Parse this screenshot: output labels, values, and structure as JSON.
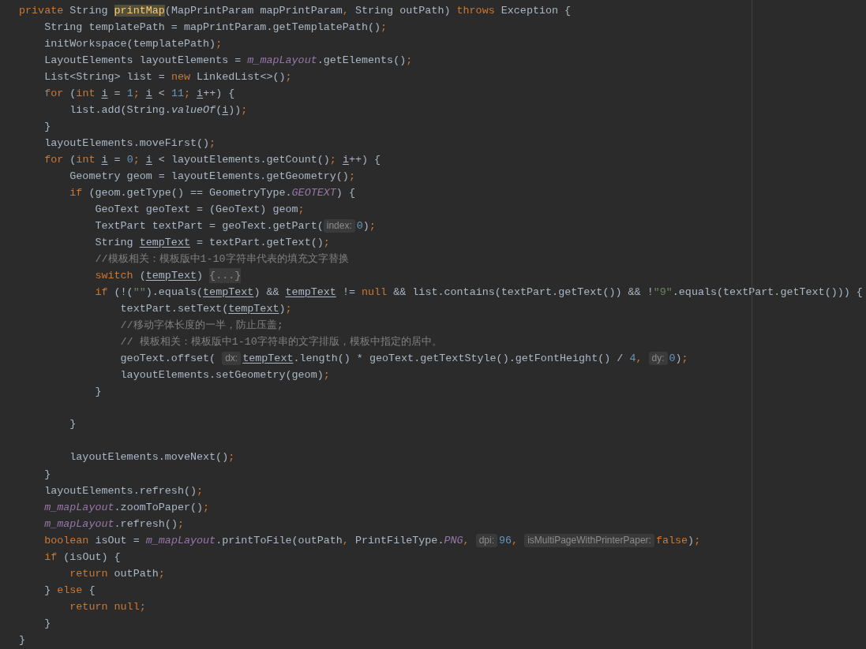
{
  "editor": {
    "lines": [
      {
        "tokens": [
          {
            "kind": "kw",
            "text": "private"
          },
          {
            "kind": "plain",
            "text": " String "
          },
          {
            "kind": "decl",
            "text": "printMap"
          },
          {
            "kind": "plain",
            "text": "(MapPrintParam mapPrintParam"
          },
          {
            "kind": "punct",
            "text": ","
          },
          {
            "kind": "plain",
            "text": " String outPath) "
          },
          {
            "kind": "kw",
            "text": "throws"
          },
          {
            "kind": "plain",
            "text": " Exception {"
          }
        ]
      },
      {
        "tokens": [
          {
            "kind": "plain",
            "text": "    String templatePath = mapPrintParam.getTemplatePath()"
          },
          {
            "kind": "punct",
            "text": ";"
          }
        ]
      },
      {
        "tokens": [
          {
            "kind": "plain",
            "text": "    initWorkspace(templatePath)"
          },
          {
            "kind": "punct",
            "text": ";"
          }
        ]
      },
      {
        "tokens": [
          {
            "kind": "plain",
            "text": "    LayoutElements layoutElements = "
          },
          {
            "kind": "field",
            "text": "m_mapLayout"
          },
          {
            "kind": "plain",
            "text": ".getElements()"
          },
          {
            "kind": "punct",
            "text": ";"
          }
        ]
      },
      {
        "tokens": [
          {
            "kind": "plain",
            "text": "    List<String> list = "
          },
          {
            "kind": "kw",
            "text": "new"
          },
          {
            "kind": "plain",
            "text": " LinkedList<>()"
          },
          {
            "kind": "punct",
            "text": ";"
          }
        ]
      },
      {
        "tokens": [
          {
            "kind": "kw",
            "text": "    for"
          },
          {
            "kind": "plain",
            "text": " ("
          },
          {
            "kind": "kw",
            "text": "int "
          },
          {
            "kind": "var",
            "text": "i"
          },
          {
            "kind": "plain",
            "text": " = "
          },
          {
            "kind": "num",
            "text": "1"
          },
          {
            "kind": "punct",
            "text": "; "
          },
          {
            "kind": "var",
            "text": "i"
          },
          {
            "kind": "plain",
            "text": " < "
          },
          {
            "kind": "num",
            "text": "11"
          },
          {
            "kind": "punct",
            "text": "; "
          },
          {
            "kind": "var",
            "text": "i"
          },
          {
            "kind": "plain",
            "text": "++) {"
          }
        ]
      },
      {
        "tokens": [
          {
            "kind": "plain",
            "text": "        list.add(String."
          },
          {
            "kind": "static",
            "text": "valueOf"
          },
          {
            "kind": "plain",
            "text": "("
          },
          {
            "kind": "var",
            "text": "i"
          },
          {
            "kind": "plain",
            "text": "))"
          },
          {
            "kind": "punct",
            "text": ";"
          }
        ]
      },
      {
        "tokens": [
          {
            "kind": "plain",
            "text": "    }"
          }
        ]
      },
      {
        "tokens": [
          {
            "kind": "plain",
            "text": "    layoutElements.moveFirst()"
          },
          {
            "kind": "punct",
            "text": ";"
          }
        ]
      },
      {
        "tokens": [
          {
            "kind": "kw",
            "text": "    for"
          },
          {
            "kind": "plain",
            "text": " ("
          },
          {
            "kind": "kw",
            "text": "int "
          },
          {
            "kind": "var",
            "text": "i"
          },
          {
            "kind": "plain",
            "text": " = "
          },
          {
            "kind": "num",
            "text": "0"
          },
          {
            "kind": "punct",
            "text": "; "
          },
          {
            "kind": "var",
            "text": "i"
          },
          {
            "kind": "plain",
            "text": " < layoutElements.getCount()"
          },
          {
            "kind": "punct",
            "text": "; "
          },
          {
            "kind": "var",
            "text": "i"
          },
          {
            "kind": "plain",
            "text": "++) {"
          }
        ]
      },
      {
        "tokens": [
          {
            "kind": "plain",
            "text": "        Geometry geom = layoutElements.getGeometry()"
          },
          {
            "kind": "punct",
            "text": ";"
          }
        ]
      },
      {
        "tokens": [
          {
            "kind": "kw",
            "text": "        if"
          },
          {
            "kind": "plain",
            "text": " (geom.getType() == GeometryType."
          },
          {
            "kind": "field",
            "text": "GEOTEXT"
          },
          {
            "kind": "plain",
            "text": ") {"
          }
        ]
      },
      {
        "tokens": [
          {
            "kind": "plain",
            "text": "            GeoText geoText = (GeoText) geom"
          },
          {
            "kind": "punct",
            "text": ";"
          }
        ]
      },
      {
        "tokens": [
          {
            "kind": "plain",
            "text": "            TextPart textPart = geoText.getPart("
          },
          {
            "kind": "hint",
            "text": "index:"
          },
          {
            "kind": "num",
            "text": "0"
          },
          {
            "kind": "plain",
            "text": ")"
          },
          {
            "kind": "punct",
            "text": ";"
          }
        ]
      },
      {
        "tokens": [
          {
            "kind": "plain",
            "text": "            String "
          },
          {
            "kind": "var",
            "text": "tempText"
          },
          {
            "kind": "plain",
            "text": " = textPart.getText()"
          },
          {
            "kind": "punct",
            "text": ";"
          }
        ]
      },
      {
        "tokens": [
          {
            "kind": "cmt",
            "text": "            //模板相关：模板版中1-10字符串代表的填充文字替换"
          }
        ]
      },
      {
        "tokens": [
          {
            "kind": "kw",
            "text": "            switch"
          },
          {
            "kind": "plain",
            "text": " ("
          },
          {
            "kind": "var",
            "text": "tempText"
          },
          {
            "kind": "plain",
            "text": ") "
          },
          {
            "kind": "fold",
            "text": "{...}"
          }
        ]
      },
      {
        "tokens": [
          {
            "kind": "kw",
            "text": "            if"
          },
          {
            "kind": "plain",
            "text": " (!("
          },
          {
            "kind": "str",
            "text": "\"\""
          },
          {
            "kind": "plain",
            "text": ").equals("
          },
          {
            "kind": "var",
            "text": "tempText"
          },
          {
            "kind": "plain",
            "text": ") && "
          },
          {
            "kind": "var",
            "text": "tempText"
          },
          {
            "kind": "plain",
            "text": " != "
          },
          {
            "kind": "kw",
            "text": "null"
          },
          {
            "kind": "plain",
            "text": " && list.contains(textPart.getText()) && !"
          },
          {
            "kind": "str",
            "text": "\"9\""
          },
          {
            "kind": "plain",
            "text": ".equals(textPart.getText())) {"
          }
        ]
      },
      {
        "tokens": [
          {
            "kind": "plain",
            "text": "                textPart.setText("
          },
          {
            "kind": "var",
            "text": "tempText"
          },
          {
            "kind": "plain",
            "text": ")"
          },
          {
            "kind": "punct",
            "text": ";"
          }
        ]
      },
      {
        "tokens": [
          {
            "kind": "cmt",
            "text": "                //移动字体长度的一半，防止压盖;"
          }
        ]
      },
      {
        "tokens": [
          {
            "kind": "cmt",
            "text": "                // 模板相关：模板版中1-10字符串的文字排版，模板中指定的居中。"
          }
        ]
      },
      {
        "tokens": [
          {
            "kind": "plain",
            "text": "                geoText.offset( "
          },
          {
            "kind": "hint",
            "text": "dx:"
          },
          {
            "kind": "var",
            "text": "tempText"
          },
          {
            "kind": "plain",
            "text": ".length() * geoText.getTextStyle().getFontHeight() / "
          },
          {
            "kind": "num",
            "text": "4"
          },
          {
            "kind": "punct",
            "text": ", "
          },
          {
            "kind": "hint",
            "text": "dy:"
          },
          {
            "kind": "num",
            "text": "0"
          },
          {
            "kind": "plain",
            "text": ")"
          },
          {
            "kind": "punct",
            "text": ";"
          }
        ]
      },
      {
        "tokens": [
          {
            "kind": "plain",
            "text": "                layoutElements.setGeometry(geom)"
          },
          {
            "kind": "punct",
            "text": ";"
          }
        ]
      },
      {
        "tokens": [
          {
            "kind": "plain",
            "text": "            }"
          }
        ]
      },
      {
        "blank_line_before": true,
        "tokens": [
          {
            "kind": "plain",
            "text": "        }"
          }
        ]
      },
      {
        "blank_line_before": true,
        "tokens": [
          {
            "kind": "plain",
            "text": "        layoutElements.moveNext()"
          },
          {
            "kind": "punct",
            "text": ";"
          }
        ]
      },
      {
        "tokens": [
          {
            "kind": "plain",
            "text": "    }"
          }
        ]
      },
      {
        "tokens": [
          {
            "kind": "plain",
            "text": "    layoutElements.refresh()"
          },
          {
            "kind": "punct",
            "text": ";"
          }
        ]
      },
      {
        "tokens": [
          {
            "kind": "field",
            "text": "    m_mapLayout"
          },
          {
            "kind": "plain",
            "text": ".zoomToPaper()"
          },
          {
            "kind": "punct",
            "text": ";"
          }
        ]
      },
      {
        "tokens": [
          {
            "kind": "field",
            "text": "    m_mapLayout"
          },
          {
            "kind": "plain",
            "text": ".refresh()"
          },
          {
            "kind": "punct",
            "text": ";"
          }
        ]
      },
      {
        "tokens": [
          {
            "kind": "kw",
            "text": "    boolean"
          },
          {
            "kind": "plain",
            "text": " isOut = "
          },
          {
            "kind": "field",
            "text": "m_mapLayout"
          },
          {
            "kind": "plain",
            "text": ".printToFile(outPath"
          },
          {
            "kind": "punct",
            "text": ","
          },
          {
            "kind": "plain",
            "text": " PrintFileType."
          },
          {
            "kind": "field",
            "text": "PNG"
          },
          {
            "kind": "punct",
            "text": ", "
          },
          {
            "kind": "hint",
            "text": "dpi:"
          },
          {
            "kind": "num",
            "text": "96"
          },
          {
            "kind": "punct",
            "text": ", "
          },
          {
            "kind": "hint",
            "text": "isMultiPageWithPrinterPaper:"
          },
          {
            "kind": "kw",
            "text": "false"
          },
          {
            "kind": "plain",
            "text": ")"
          },
          {
            "kind": "punct",
            "text": ";"
          }
        ]
      },
      {
        "tokens": [
          {
            "kind": "kw",
            "text": "    if"
          },
          {
            "kind": "plain",
            "text": " (isOut) {"
          }
        ]
      },
      {
        "tokens": [
          {
            "kind": "kw",
            "text": "        return"
          },
          {
            "kind": "plain",
            "text": " outPath"
          },
          {
            "kind": "punct",
            "text": ";"
          }
        ]
      },
      {
        "tokens": [
          {
            "kind": "plain",
            "text": "    } "
          },
          {
            "kind": "kw",
            "text": "else"
          },
          {
            "kind": "plain",
            "text": " {"
          }
        ]
      },
      {
        "tokens": [
          {
            "kind": "kw",
            "text": "        return null"
          },
          {
            "kind": "punct",
            "text": ";"
          }
        ]
      },
      {
        "tokens": [
          {
            "kind": "plain",
            "text": "    }"
          }
        ]
      },
      {
        "tokens": [
          {
            "kind": "plain",
            "text": "}"
          }
        ]
      }
    ]
  }
}
